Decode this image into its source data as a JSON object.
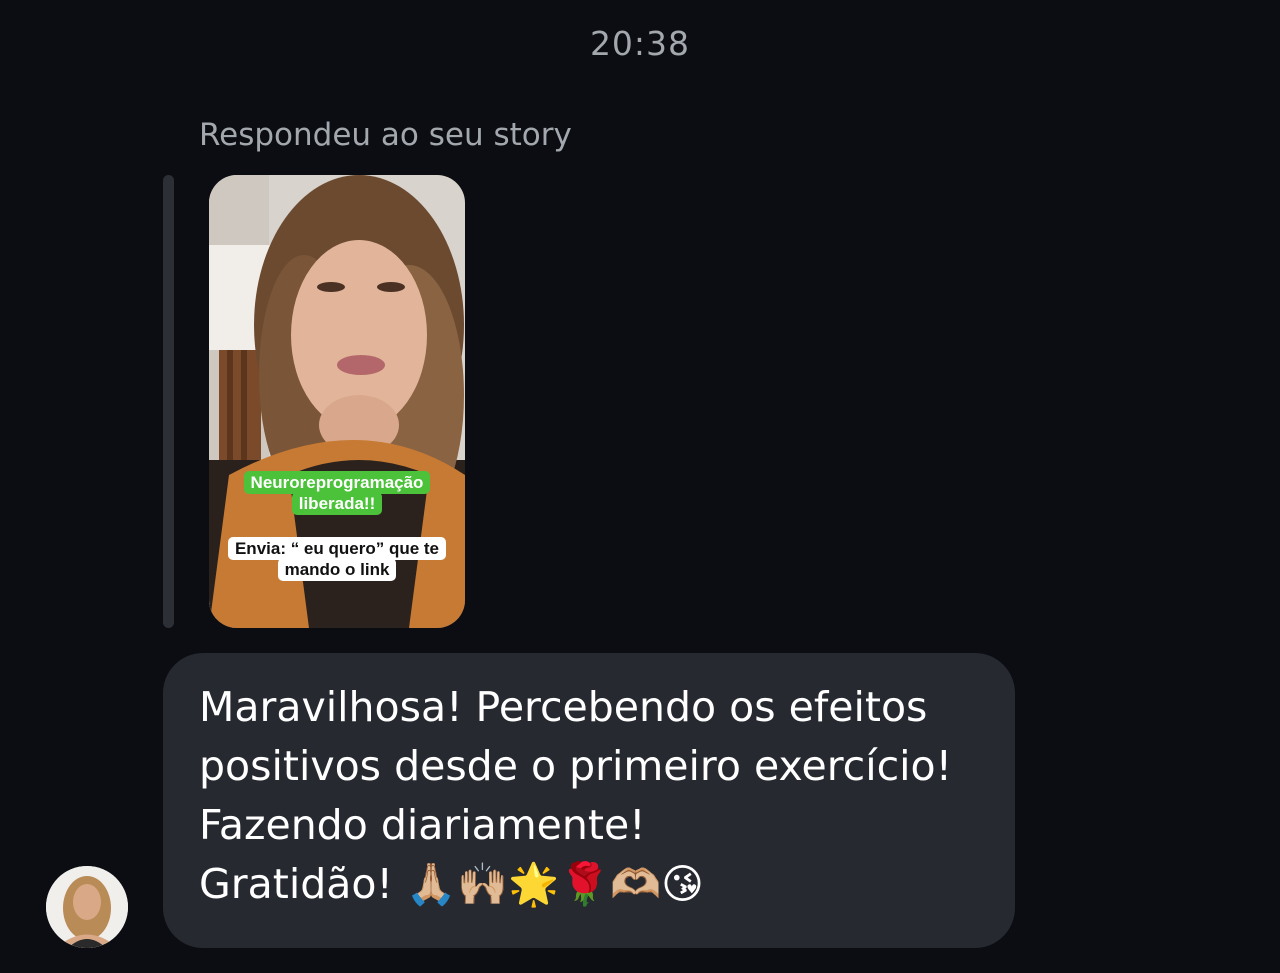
{
  "header": {
    "timestamp": "20:38"
  },
  "story_reply": {
    "caption": "Respondeu ao seu story",
    "sticker_green": "Neuroreprogramação liberada!!",
    "sticker_white": "Envia: “ eu quero” que te mando o link",
    "sticker_green_color": "#4bc23a"
  },
  "message": {
    "text": "Maravilhosa! Percebendo os efeitos\npositivos desde o primeiro exercício!\nFazendo diariamente!\nGratidão! 🙏🏼🙌🏼🌟🌹🫶🏼😘"
  },
  "sender": {
    "avatar_icon": "profile-photo"
  },
  "colors": {
    "background": "#0b0d12",
    "bubble": "#262930",
    "muted_text": "#a3a7ae"
  }
}
